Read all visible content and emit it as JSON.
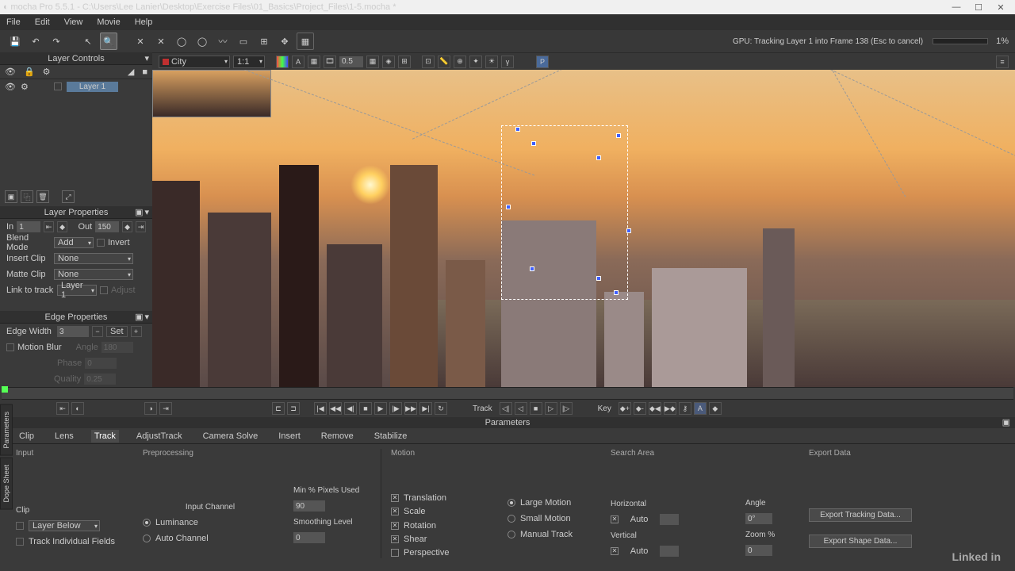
{
  "title": "mocha Pro 5.5.1 - C:\\Users\\Lee Lanier\\Desktop\\Exercise Files\\01_Basics\\Project_Files\\1-5.mocha *",
  "menu": {
    "file": "File",
    "edit": "Edit",
    "view": "View",
    "movie": "Movie",
    "help": "Help"
  },
  "gpu_status": "GPU: Tracking Layer 1 into Frame 138 (Esc to cancel)",
  "progress_pct": "1%",
  "clip_dropdown": "City",
  "zoom_dropdown": "1:1",
  "opacity_val": "0.5",
  "proxy_btn": "P",
  "left": {
    "layer_controls": "Layer Controls",
    "layer1": "Layer 1",
    "layer_properties": "Layer Properties",
    "in_lbl": "In",
    "in_val": "1",
    "out_lbl": "Out",
    "out_val": "150",
    "blend_lbl": "Blend Mode",
    "blend_val": "Add",
    "invert": "Invert",
    "insert_lbl": "Insert Clip",
    "insert_val": "None",
    "matte_lbl": "Matte Clip",
    "matte_val": "None",
    "link_lbl": "Link to track",
    "link_val": "Layer 1",
    "adjust": "Adjust",
    "edge_properties": "Edge Properties",
    "edge_width_lbl": "Edge Width",
    "edge_width_val": "3",
    "set": "Set",
    "motion_blur": "Motion Blur",
    "angle_lbl": "Angle",
    "angle_val": "180",
    "phase_lbl": "Phase",
    "phase_val": "0",
    "quality_lbl": "Quality",
    "quality_val": "0.25"
  },
  "transport": {
    "track_lbl": "Track",
    "key_lbl": "Key"
  },
  "params_header": "Parameters",
  "tabs": {
    "clip": "Clip",
    "lens": "Lens",
    "track": "Track",
    "adjust": "AdjustTrack",
    "camera": "Camera Solve",
    "insert": "Insert",
    "remove": "Remove",
    "stabilize": "Stabilize"
  },
  "side": {
    "params": "Parameters",
    "dope": "Dope Sheet"
  },
  "track_panel": {
    "input": "Input",
    "preprocessing": "Preprocessing",
    "motion": "Motion",
    "search": "Search Area",
    "export": "Export Data",
    "clip_lbl": "Clip",
    "clip_val": "Layer Below",
    "track_fields": "Track Individual Fields",
    "input_channel": "Input Channel",
    "luminance": "Luminance",
    "auto_channel": "Auto Channel",
    "min_pct": "Min % Pixels Used",
    "min_pct_val": "90",
    "smooth": "Smoothing Level",
    "smooth_val": "0",
    "translation": "Translation",
    "scale": "Scale",
    "rotation": "Rotation",
    "shear": "Shear",
    "perspective": "Perspective",
    "large_motion": "Large Motion",
    "small_motion": "Small Motion",
    "manual": "Manual Track",
    "horizontal": "Horizontal",
    "vertical": "Vertical",
    "auto": "Auto",
    "h_val": "",
    "angle": "Angle",
    "angle_val": "0°",
    "zoom": "Zoom %",
    "zoom_val": "0",
    "export_track": "Export Tracking Data...",
    "export_shape": "Export Shape Data..."
  },
  "linkedin": "Linked in"
}
